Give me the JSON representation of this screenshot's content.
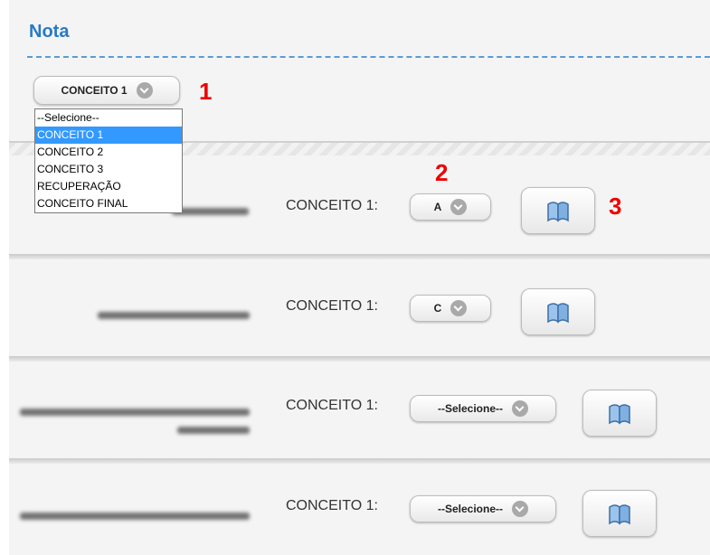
{
  "header": {
    "title": "Nota"
  },
  "top_select": {
    "value": "CONCEITO 1"
  },
  "dropdown": {
    "options": [
      "--Selecione--",
      "CONCEITO 1",
      "CONCEITO 2",
      "CONCEITO 3",
      "RECUPERAÇÃO",
      "CONCEITO FINAL"
    ],
    "selected": "CONCEITO 1"
  },
  "annotations": [
    "1",
    "2",
    "3"
  ],
  "rows": [
    {
      "label": "CONCEITO 1:",
      "value": "A"
    },
    {
      "label": "CONCEITO 1:",
      "value": "C"
    },
    {
      "label": "CONCEITO 1:",
      "value": "--Selecione--"
    },
    {
      "label": "CONCEITO 1:",
      "value": "--Selecione--"
    }
  ],
  "icons": {
    "book": "book-icon",
    "chevron": "chevron-down-icon"
  },
  "colors": {
    "title": "#2a79c4",
    "annotation": "#ee0000",
    "highlight": "#3399ff"
  }
}
